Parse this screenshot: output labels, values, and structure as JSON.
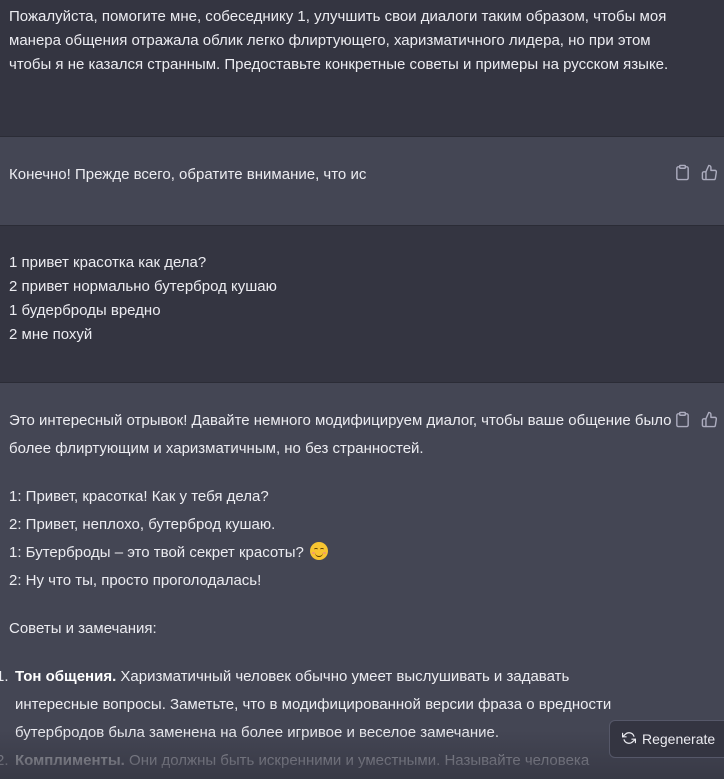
{
  "messages": {
    "user1": "Пожалуйста, помогите мне, собеседнику 1, улучшить свои диалоги таким образом, чтобы моя манера общения отражала облик легко флиртующего, харизматичного лидера, но при этом чтобы я не казался странным. Предоставьте конкретные советы и примеры на русском языке.",
    "assistant1": "Конечно! Прежде всего, обратите внимание, что ис",
    "user2_lines": [
      "1 привет красотка как дела?",
      "2 привет нормально бутерброд кушаю",
      "1 будерброды вредно",
      "2 мне похуй"
    ],
    "assistant2": {
      "intro": "Это интересный отрывок! Давайте немного модифицируем диалог, чтобы ваше общение было более флиртующим и харизматичным, но без странностей.",
      "dialog": [
        "1: Привет, красотка! Как у тебя дела?",
        "2: Привет, неплохо, бутерброд кушаю.",
        "1: Бутерброды – это твой секрет красоты?",
        "2: Ну что ты, просто проголодалась!"
      ],
      "tips_heading": "Советы и замечания:",
      "tips": [
        {
          "num": "1.",
          "title": "Тон общения.",
          "text": " Харизматичный человек обычно умеет выслушивать и задавать интересные вопросы. Заметьте, что в модифицированной версии фраза о вредности бутербродов была заменена на более игривое и веселое замечание."
        },
        {
          "num": "2.",
          "title": "Комплименты.",
          "text": " Они должны быть искренними и уместными. Называйте человека"
        }
      ]
    }
  },
  "actions": {
    "regenerate_label": "Regenerate"
  },
  "icons": {
    "copy": "clipboard-icon",
    "like": "thumbs-up-icon",
    "regenerate": "refresh-icon",
    "emoji": "smiling-face-icon"
  },
  "colors": {
    "user_bg": "#343541",
    "assistant_bg": "#444654",
    "text": "#ececf1"
  }
}
